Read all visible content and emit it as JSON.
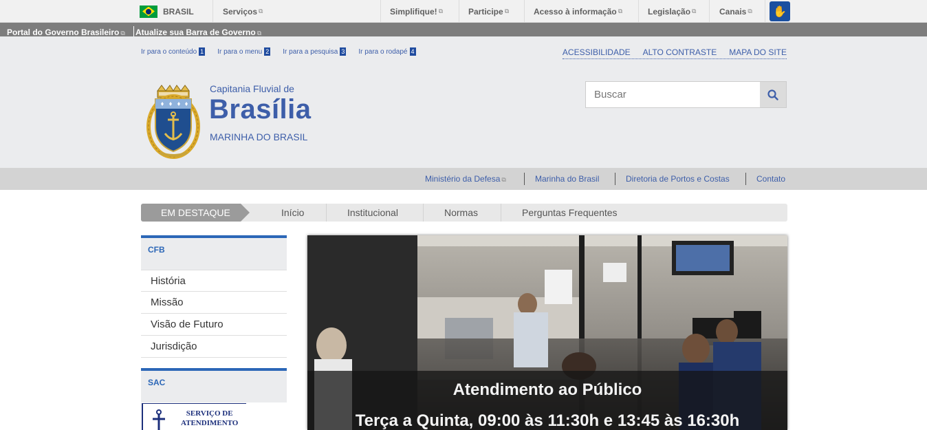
{
  "govbar": {
    "brasil": "BRASIL",
    "items": [
      "Serviços",
      "Simplifique!",
      "Participe",
      "Acesso à informação",
      "Legislação",
      "Canais"
    ]
  },
  "graybar": {
    "portal": "Portal do Governo Brasileiro",
    "atualize": "Atualize sua Barra de Governo"
  },
  "skip_links": [
    {
      "label": "Ir para o conteúdo",
      "num": "1"
    },
    {
      "label": "Ir para o menu",
      "num": "2"
    },
    {
      "label": "Ir para a pesquisa",
      "num": "3"
    },
    {
      "label": "Ir para o rodapé",
      "num": "4"
    }
  ],
  "top_links": [
    "ACESSIBILIDADE",
    "ALTO CONTRASTE",
    "MAPA DO SITE"
  ],
  "site": {
    "subtitle": "Capitania Fluvial de",
    "title": "Brasília",
    "org": "MARINHA DO BRASIL"
  },
  "search": {
    "placeholder": "Buscar"
  },
  "service_links": [
    "Ministério da Defesa",
    "Marinha do Brasil",
    "Diretoria de Portos e Costas",
    "Contato"
  ],
  "menu": {
    "destaque": "EM DESTAQUE",
    "items": [
      "Início",
      "Institucional",
      "Normas",
      "Perguntas Frequentes"
    ]
  },
  "sidebar": {
    "cfb": {
      "heading": "CFB",
      "items": [
        "História",
        "Missão",
        "Visão de Futuro",
        "Jurisdição"
      ]
    },
    "sac": {
      "heading": "SAC",
      "banner_line1": "SERVIÇO DE",
      "banner_line2": "ATENDIMENTO"
    }
  },
  "hero": {
    "caption_title": "Atendimento ao Público",
    "caption_hours": "Terça a Quinta, 09:00 às 11:30h e 13:45 às 16:30h"
  },
  "colors": {
    "brand_blue": "#3d5ea9",
    "accent_blue": "#2c67b7",
    "gray_bar": "#7d7d7d"
  }
}
